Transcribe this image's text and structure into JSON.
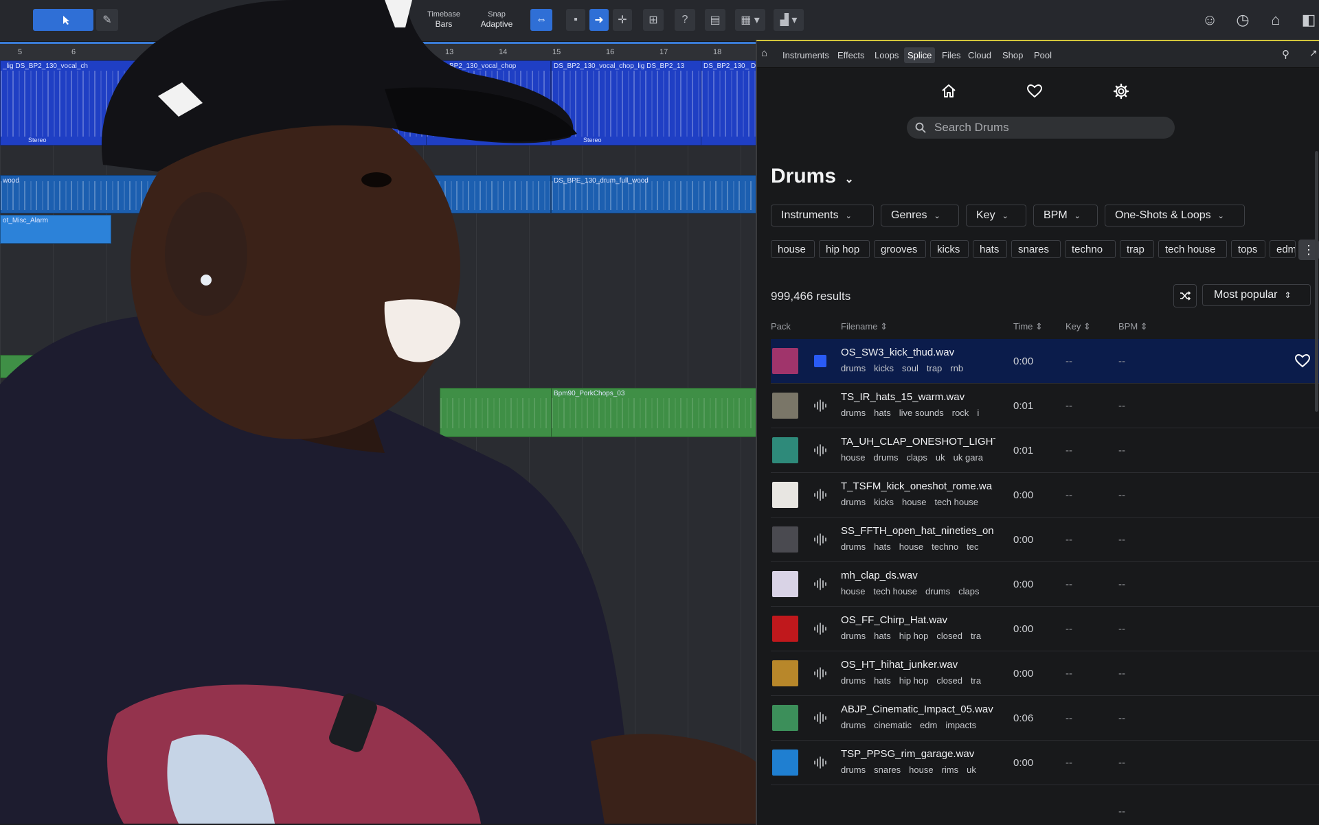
{
  "toolbar": {
    "timebase_label": "Timebase",
    "timebase_value": "Bars",
    "snap_label": "Snap",
    "snap_value": "Adaptive",
    "help_glyph": "?"
  },
  "arrangement": {
    "ruler": [
      "5",
      "6",
      "13",
      "14",
      "15",
      "16",
      "17",
      "18"
    ],
    "clips": {
      "vocal_1": "_lig  DS_BP2_130_vocal_ch",
      "vocal_2": "ip  DS_BP2_130_vocal_chop",
      "vocal_3": "DS_BP2_130_vocal_chop_lig  DS_BP2_13",
      "vocal_4": "DS_BP2_130_  Di",
      "stereo": "Stereo",
      "drum_1": "wood",
      "drum_2": "DS_BPE_130_drum_full_wood",
      "alarm": "ot_Misc_Alarm",
      "green": "Bpm90_PorkChops_03"
    }
  },
  "browser": {
    "tabs": [
      "Instruments",
      "Effects",
      "Loops",
      "Splice",
      "Files",
      "Cloud",
      "Shop",
      "Pool"
    ],
    "active_tab": "Splice"
  },
  "splice": {
    "search_placeholder": "Search Drums",
    "title": "Drums",
    "filters": [
      "Instruments",
      "Genres",
      "Key",
      "BPM",
      "One-Shots & Loops"
    ],
    "tags": [
      "house",
      "hip hop",
      "grooves",
      "kicks",
      "hats",
      "snares",
      "techno",
      "trap",
      "tech house",
      "tops",
      "edm"
    ],
    "result_count": "999,466 results",
    "sort_label": "Most popular",
    "columns": {
      "pack": "Pack",
      "filename": "Filename",
      "time": "Time",
      "key": "Key",
      "bpm": "BPM"
    },
    "results": [
      {
        "filename": "OS_SW3_kick_thud.wav",
        "tags": [
          "drums",
          "kicks",
          "soul",
          "trap",
          "rnb"
        ],
        "time": "0:00",
        "key": "--",
        "bpm": "--",
        "art": "#a0346b"
      },
      {
        "filename": "TS_IR_hats_15_warm.wav",
        "tags": [
          "drums",
          "hats",
          "live sounds",
          "rock",
          "i"
        ],
        "time": "0:01",
        "key": "--",
        "bpm": "--",
        "art": "#7a7668"
      },
      {
        "filename": "TA_UH_CLAP_ONESHOT_LIGHT_",
        "tags": [
          "house",
          "drums",
          "claps",
          "uk",
          "uk gara"
        ],
        "time": "0:01",
        "key": "--",
        "bpm": "--",
        "art": "#2e8a7a"
      },
      {
        "filename": "T_TSFM_kick_oneshot_rome.wa",
        "tags": [
          "drums",
          "kicks",
          "house",
          "tech house"
        ],
        "time": "0:00",
        "key": "--",
        "bpm": "--",
        "art": "#e8e6e2"
      },
      {
        "filename": "SS_FFTH_open_hat_nineties_on",
        "tags": [
          "drums",
          "hats",
          "house",
          "techno",
          "tec"
        ],
        "time": "0:00",
        "key": "--",
        "bpm": "--",
        "art": "#4a4a50"
      },
      {
        "filename": "mh_clap_ds.wav",
        "tags": [
          "house",
          "tech house",
          "drums",
          "claps"
        ],
        "time": "0:00",
        "key": "--",
        "bpm": "--",
        "art": "#d9d3e6"
      },
      {
        "filename": "OS_FF_Chirp_Hat.wav",
        "tags": [
          "drums",
          "hats",
          "hip hop",
          "closed",
          "tra"
        ],
        "time": "0:00",
        "key": "--",
        "bpm": "--",
        "art": "#c0181c"
      },
      {
        "filename": "OS_HT_hihat_junker.wav",
        "tags": [
          "drums",
          "hats",
          "hip hop",
          "closed",
          "tra"
        ],
        "time": "0:00",
        "key": "--",
        "bpm": "--",
        "art": "#b8872a"
      },
      {
        "filename": "ABJP_Cinematic_Impact_05.wav",
        "tags": [
          "drums",
          "cinematic",
          "edm",
          "impacts"
        ],
        "time": "0:06",
        "key": "--",
        "bpm": "--",
        "art": "#3c8f5a"
      },
      {
        "filename": "TSP_PPSG_rim_garage.wav",
        "tags": [
          "drums",
          "snares",
          "house",
          "rims",
          "uk"
        ],
        "time": "0:00",
        "key": "--",
        "bpm": "--",
        "art": "#1f7fd1"
      }
    ],
    "last_row_bpm": "--"
  },
  "colors": {
    "accent_blue": "#2f6fd6",
    "selected_row": "#0b1c4b",
    "vocal_clip": "#1f3fc4",
    "drum_clip": "#1c5fb0",
    "green_clip": "#3f8f46"
  }
}
